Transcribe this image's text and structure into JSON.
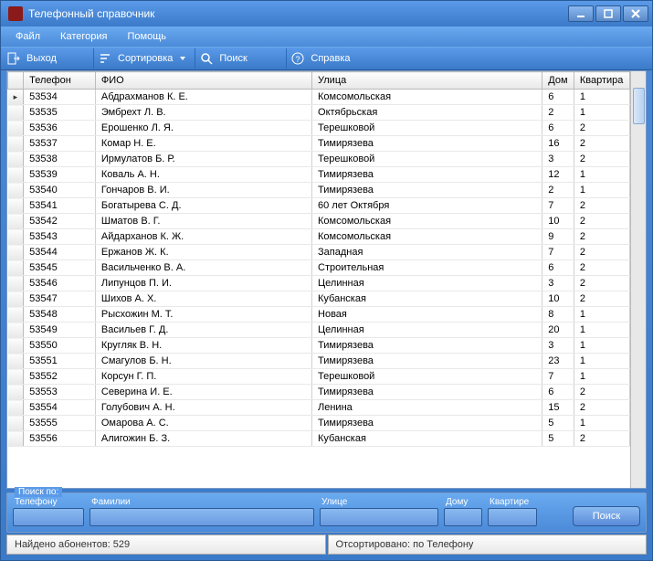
{
  "window": {
    "title": "Телефонный справочник"
  },
  "menu": {
    "file": "Файл",
    "category": "Категория",
    "help": "Помощь"
  },
  "toolbar": {
    "exit": "Выход",
    "sort": "Сортировка",
    "search": "Поиск",
    "about": "Справка"
  },
  "grid": {
    "columns": {
      "phone": "Телефон",
      "fio": "ФИО",
      "street": "Улица",
      "house": "Дом",
      "apt": "Квартира"
    },
    "rows": [
      {
        "phone": "53534",
        "fio": "Абдрахманов К. Е.",
        "street": "Комсомольская",
        "house": "6",
        "apt": "1"
      },
      {
        "phone": "53535",
        "fio": "Эмбрехт Л. В.",
        "street": "Октябрьская",
        "house": "2",
        "apt": "1"
      },
      {
        "phone": "53536",
        "fio": "Ерошенко Л. Я.",
        "street": "Терешковой",
        "house": "6",
        "apt": "2"
      },
      {
        "phone": "53537",
        "fio": "Комар Н. Е.",
        "street": "Тимирязева",
        "house": "16",
        "apt": "2"
      },
      {
        "phone": "53538",
        "fio": "Ирмулатов Б. Р.",
        "street": "Терешковой",
        "house": "3",
        "apt": "2"
      },
      {
        "phone": "53539",
        "fio": "Коваль А. Н.",
        "street": "Тимирязева",
        "house": "12",
        "apt": "1"
      },
      {
        "phone": "53540",
        "fio": "Гончаров В. И.",
        "street": "Тимирязева",
        "house": "2",
        "apt": "1"
      },
      {
        "phone": "53541",
        "fio": "Богатырева С. Д.",
        "street": "60 лет Октября",
        "house": "7",
        "apt": "2"
      },
      {
        "phone": "53542",
        "fio": "Шматов В. Г.",
        "street": "Комсомольская",
        "house": "10",
        "apt": "2"
      },
      {
        "phone": "53543",
        "fio": "Айдарханов К. Ж.",
        "street": "Комсомольская",
        "house": "9",
        "apt": "2"
      },
      {
        "phone": "53544",
        "fio": "Ержанов Ж. К.",
        "street": "Западная",
        "house": "7",
        "apt": "2"
      },
      {
        "phone": "53545",
        "fio": "Васильченко В. А.",
        "street": "Строительная",
        "house": "6",
        "apt": "2"
      },
      {
        "phone": "53546",
        "fio": "Липунцов П. И.",
        "street": "Целинная",
        "house": "3",
        "apt": "2"
      },
      {
        "phone": "53547",
        "fio": "Шихов А. Х.",
        "street": "Кубанская",
        "house": "10",
        "apt": "2"
      },
      {
        "phone": "53548",
        "fio": "Рысхожин М. Т.",
        "street": "Новая",
        "house": "8",
        "apt": "1"
      },
      {
        "phone": "53549",
        "fio": "Васильев Г. Д.",
        "street": "Целинная",
        "house": "20",
        "apt": "1"
      },
      {
        "phone": "53550",
        "fio": "Кругляк В. Н.",
        "street": "Тимирязева",
        "house": "3",
        "apt": "1"
      },
      {
        "phone": "53551",
        "fio": "Смагулов Б. Н.",
        "street": "Тимирязева",
        "house": "23",
        "apt": "1"
      },
      {
        "phone": "53552",
        "fio": "Корсун Г. П.",
        "street": "Терешковой",
        "house": "7",
        "apt": "1"
      },
      {
        "phone": "53553",
        "fio": "Северина И. Е.",
        "street": "Тимирязева",
        "house": "6",
        "apt": "2"
      },
      {
        "phone": "53554",
        "fio": "Голубович А. Н.",
        "street": "Ленина",
        "house": "15",
        "apt": "2"
      },
      {
        "phone": "53555",
        "fio": "Омарова А. С.",
        "street": "Тимирязева",
        "house": "5",
        "apt": "1"
      },
      {
        "phone": "53556",
        "fio": "Алигожин Б. З.",
        "street": "Кубанская",
        "house": "5",
        "apt": "2"
      }
    ]
  },
  "search": {
    "legend": "Поиск по:",
    "labels": {
      "phone": "Телефону",
      "surname": "Фамилии",
      "street": "Улице",
      "house": "Дому",
      "apt": "Квартире"
    },
    "button": "Поиск"
  },
  "status": {
    "found_label": "Найдено абонентов:",
    "found_count": "529",
    "sorted_label": "Отсортировано: по",
    "sorted_by": "Телефону"
  }
}
